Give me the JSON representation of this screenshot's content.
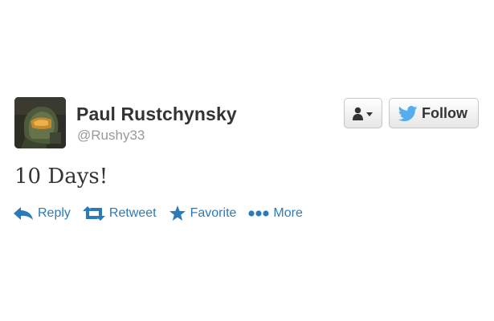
{
  "tweet": {
    "author": {
      "name": "Paul Rustchynsky",
      "handle": "@Rushy33",
      "avatar": "helmet-avatar"
    },
    "text": "10 Days!"
  },
  "buttons": {
    "user_menu_icon": "user-dropdown-icon",
    "follow_label": "Follow",
    "follow_icon": "twitter-bird-icon"
  },
  "actions": [
    {
      "label": "Reply",
      "icon": "reply-arrow-icon"
    },
    {
      "label": "Retweet",
      "icon": "retweet-icon"
    },
    {
      "label": "Favorite",
      "icon": "star-icon"
    },
    {
      "label": "More",
      "icon": "more-dots-icon"
    }
  ],
  "colors": {
    "accent": "#2b7bb9",
    "name": "#333333",
    "handle": "#999999",
    "bird": "#55acee"
  }
}
